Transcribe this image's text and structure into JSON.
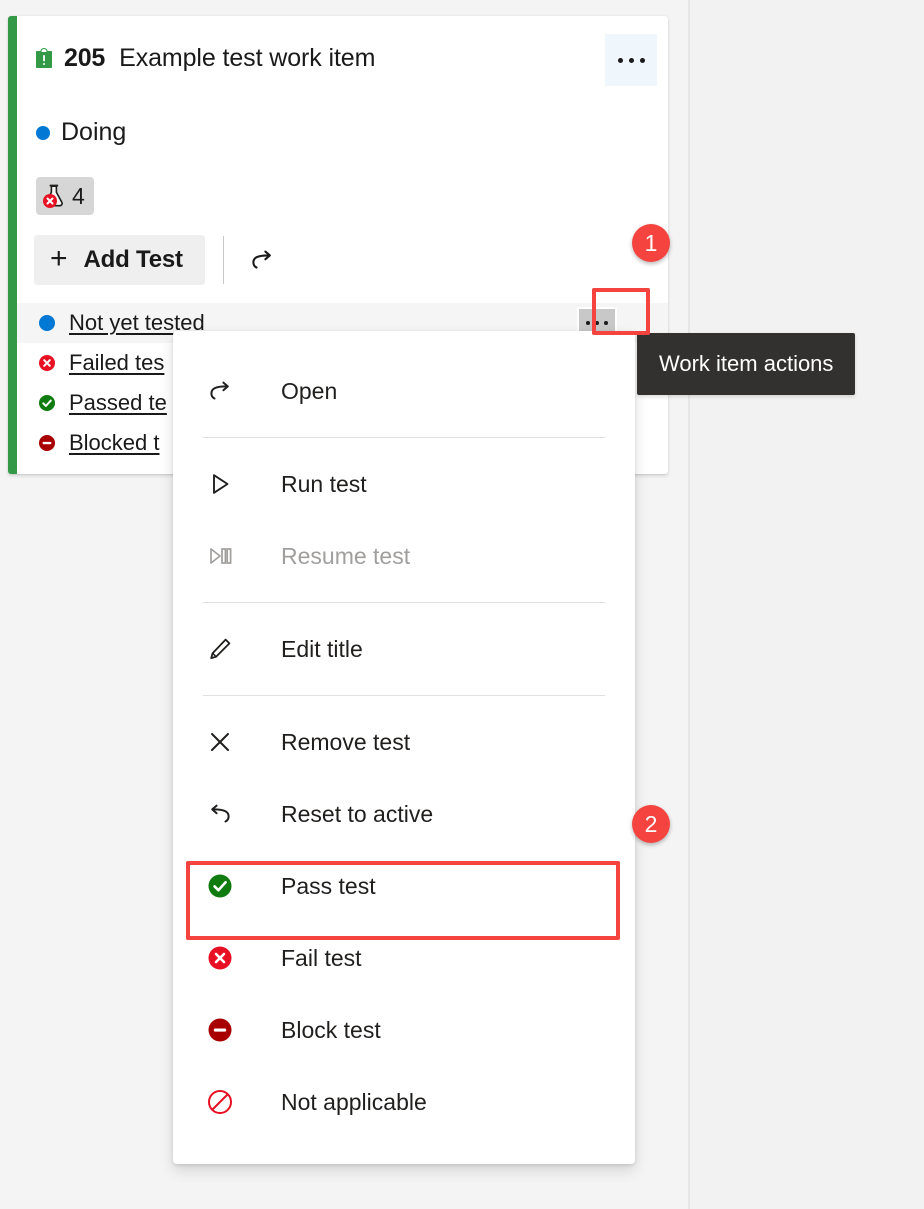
{
  "board": {
    "background_color": "#f3f3f3",
    "column_divider_color": "#e6e6e6"
  },
  "card": {
    "type_stripe_color": "#339947",
    "work_item_type_icon": "issue-clipboard-icon",
    "id": "205",
    "title": "Example test work item",
    "state": {
      "label": "Doing",
      "dot_color": "#0078d4"
    },
    "test_summary": {
      "icon": "flask-failed-icon",
      "count": "4",
      "background_color": "#d6d6d6"
    },
    "actions_button": {
      "icon": "ellipsis-icon",
      "hover_background": "#eff6fc"
    },
    "toolbar": {
      "add_test_label": "Add Test",
      "add_test_icon": "plus-icon",
      "refresh_icon": "refresh-redo-icon"
    },
    "test_list": [
      {
        "name": "Not yet tested",
        "outcome_icon": "not-run-blue-circle-icon",
        "outcome_color": "#0078d4",
        "hovered": true
      },
      {
        "name": "Failed tes",
        "outcome_icon": "failed-red-x-icon",
        "outcome_color": "#e81123",
        "hovered": false
      },
      {
        "name": "Passed te",
        "outcome_icon": "passed-green-check-icon",
        "outcome_color": "#107c10",
        "hovered": false
      },
      {
        "name": "Blocked t",
        "outcome_icon": "blocked-dark-red-minus-icon",
        "outcome_color": "#a80000",
        "hovered": false
      }
    ],
    "test_row_actions_button": {
      "icon": "ellipsis-icon",
      "background_color": "#c8c8c8"
    }
  },
  "tooltip": {
    "text": "Work item actions",
    "background_color": "#323130",
    "text_color": "#ffffff"
  },
  "annotations": {
    "highlight_color": "#f5443f",
    "badges": [
      {
        "number": "1",
        "target": "test-row-actions-button"
      },
      {
        "number": "2",
        "target": "pass-test-menu-item"
      }
    ]
  },
  "context_menu": {
    "items": [
      {
        "label": "Open",
        "icon": "open-arrow-icon",
        "disabled": false,
        "highlighted": false,
        "separator_after": true
      },
      {
        "label": "Run test",
        "icon": "play-triangle-icon",
        "disabled": false,
        "highlighted": false,
        "separator_after": false
      },
      {
        "label": "Resume test",
        "icon": "resume-play-icon",
        "disabled": true,
        "highlighted": false,
        "separator_after": true
      },
      {
        "label": "Edit title",
        "icon": "pencil-edit-icon",
        "disabled": false,
        "highlighted": false,
        "separator_after": true
      },
      {
        "label": "Remove test",
        "icon": "close-x-icon",
        "disabled": false,
        "highlighted": false,
        "separator_after": false
      },
      {
        "label": "Reset to active",
        "icon": "undo-arrow-icon",
        "disabled": false,
        "highlighted": false,
        "separator_after": false
      },
      {
        "label": "Pass test",
        "icon": "passed-green-check-icon",
        "disabled": false,
        "highlighted": true,
        "separator_after": false
      },
      {
        "label": "Fail test",
        "icon": "failed-red-x-icon",
        "disabled": false,
        "highlighted": false,
        "separator_after": false
      },
      {
        "label": "Block test",
        "icon": "blocked-dark-red-minus-icon",
        "disabled": false,
        "highlighted": false,
        "separator_after": false
      },
      {
        "label": "Not applicable",
        "icon": "not-applicable-slash-icon",
        "disabled": false,
        "highlighted": false,
        "separator_after": false
      }
    ]
  }
}
